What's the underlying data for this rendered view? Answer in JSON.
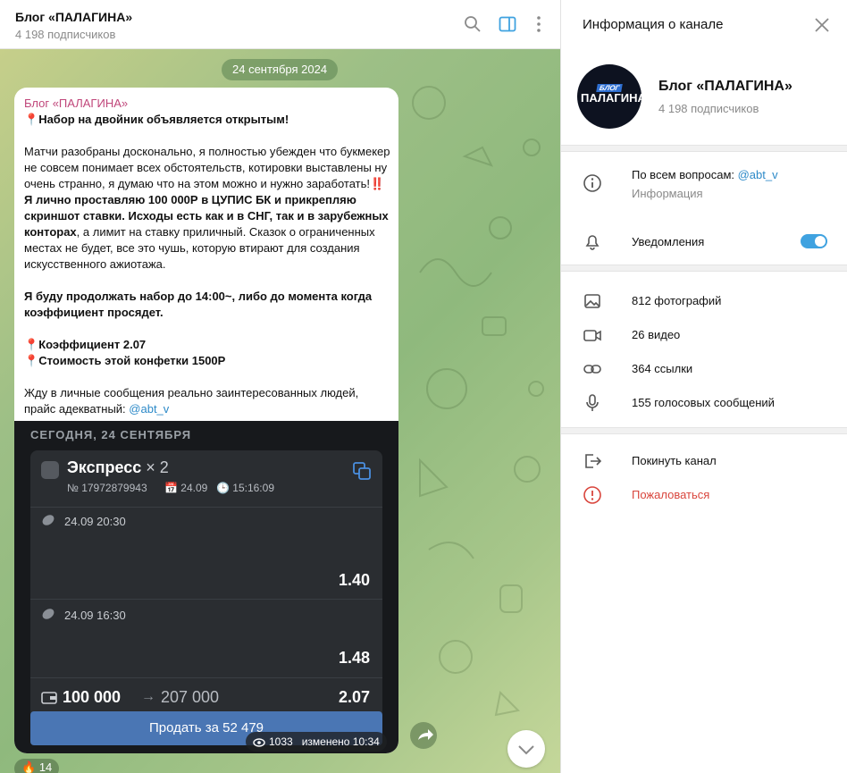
{
  "chat": {
    "title": "Блог «ПАЛАГИНА»",
    "subscribers": "4 198 подписчиков",
    "date_pill": "24 сентября 2024",
    "post": {
      "author": "Блог «ПАЛАГИНА»",
      "line1": "Набор на двойник объявляется открытым!",
      "p2": "Матчи разобраны досконально, я полностью убежден что букмекер не совсем понимает всех обстоятельств, котировки выставлены ну очень странно, я думаю что на этом можно и нужно заработать!",
      "bang": "‼️",
      "p2_bold": "Я лично проставляю 100 000Р в ЦУПИС БК и прикрепляю скриншот ставки. Исходы есть как и в СНГ, так и в зарубежных конторах",
      "p2_tail": ", а лимит на ставку приличный. Сказок о ограниченных местах не будет, все это чушь, которую втирают для создания искусственного ажиотажа.",
      "p3": "Я буду продолжать набор до 14:00~, либо до момента когда коэффициент просядет.",
      "coef": "Коэффициент 2.07",
      "price": "Стоимость этой конфетки 1500Р",
      "p5": "Жду в личные сообщения реально заинтересованных людей, прайс адекватный: ",
      "mention": "@abt_v"
    },
    "bet": {
      "header": "СЕГОДНЯ, 24 СЕНТЯБРЯ",
      "title": "Экспресс",
      "mult": " × 2",
      "number": "№ 17972879943",
      "date": "24.09",
      "time": "15:16:09",
      "legs": [
        {
          "datetime": "24.09   20:30",
          "odds": "1.40"
        },
        {
          "datetime": "24.09   16:30",
          "odds": "1.48"
        }
      ],
      "stake": "100 000",
      "arrow": "→",
      "win": "207 000",
      "total_odds": "2.07",
      "sell": "Продать за 52 479"
    },
    "meta": {
      "views": "1033",
      "edited": "изменено 10:34"
    },
    "reaction": {
      "emoji": "🔥",
      "count": "14"
    }
  },
  "info": {
    "title": "Информация о канале",
    "channel_name": "Блог «ПАЛАГИНА»",
    "subscribers": "4 198 подписчиков",
    "avatar_small": "БЛОГ",
    "avatar_big": "ПАЛАГИНА",
    "contact_prefix": "По всем вопросам: ",
    "contact_mention": "@abt_v",
    "contact_sub": "Информация",
    "notifications": "Уведомления",
    "notifications_on": true,
    "photos": "812 фотографий",
    "videos": "26 видео",
    "links": "364 ссылки",
    "voice": "155 голосовых сообщений",
    "leave": "Покинуть канал",
    "report": "Пожаловаться"
  },
  "colors": {
    "accent": "#3fa2e0",
    "danger": "#d9453c",
    "author": "#c0467a",
    "sell_button": "#4a76b4"
  }
}
